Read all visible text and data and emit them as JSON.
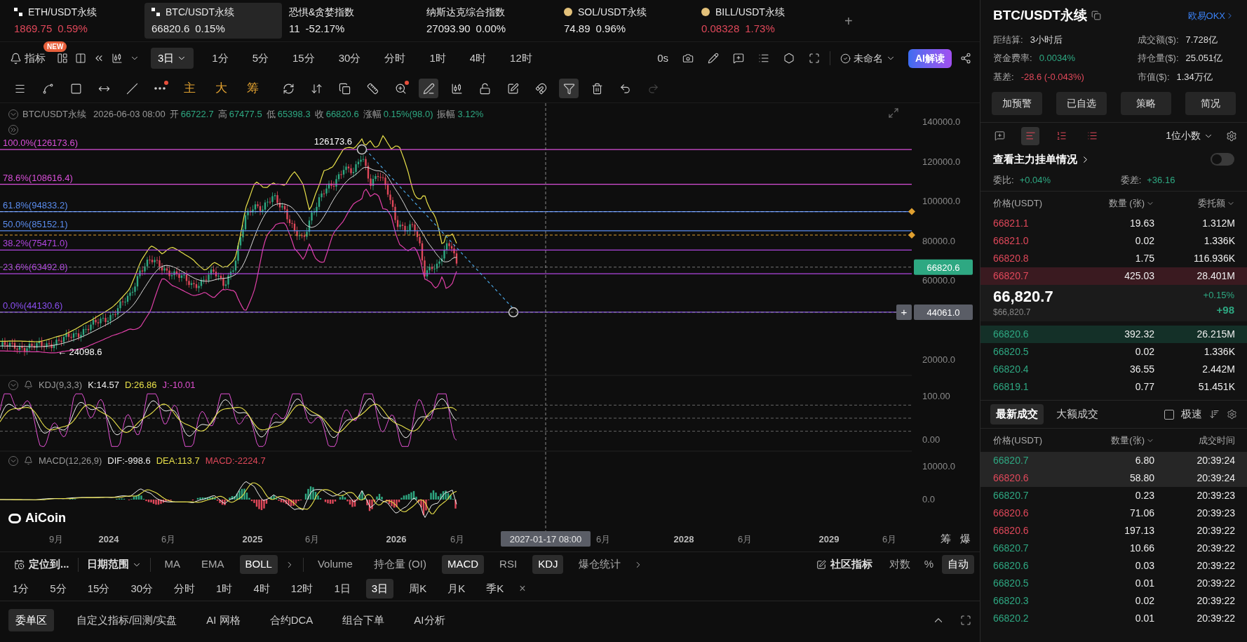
{
  "tickers": [
    {
      "symbol": "ETH/USDT永续",
      "price": "1869.75",
      "change": "0.59%",
      "color": "#e0485a",
      "selected": false
    },
    {
      "symbol": "BTC/USDT永续",
      "price": "66820.6",
      "change": "0.15%",
      "color": "#e8e8e8",
      "selected": true
    },
    {
      "symbol": "恐惧&贪婪指数",
      "price": "11",
      "change": "-52.17%",
      "color": "#e8e8e8",
      "selected": false
    },
    {
      "symbol": "纳斯达克综合指数",
      "price": "27093.90",
      "change": "0.00%",
      "color": "#e8e8e8",
      "selected": false
    },
    {
      "symbol": "SOL/USDT永续",
      "price": "74.89",
      "change": "0.96%",
      "color": "#e8e8e8",
      "selected": false
    },
    {
      "symbol": "BILL/USDT永续",
      "price": "0.08328",
      "change": "1.73%",
      "color": "#e0485a",
      "selected": false
    }
  ],
  "add_tab": "+",
  "toolbar": {
    "indicator": "指标",
    "badge": "NEW",
    "period": "3日",
    "timeframes": [
      "1分",
      "5分",
      "15分",
      "30分",
      "分时",
      "1时",
      "4时",
      "12时"
    ],
    "countdown": "0s",
    "layout_name": "未命名",
    "ai_button": "AI解读"
  },
  "drawing_tools": [
    {
      "kind": "icon",
      "selected": false,
      "disabled": false
    },
    {
      "kind": "icon",
      "selected": false,
      "disabled": false
    },
    {
      "kind": "icon",
      "selected": false,
      "disabled": false
    },
    {
      "kind": "icon",
      "selected": false,
      "disabled": false
    },
    {
      "kind": "icon",
      "selected": false,
      "disabled": false
    },
    {
      "kind": "icon",
      "selected": false,
      "disabled": false
    },
    {
      "kind": "text",
      "label": "主"
    },
    {
      "kind": "text",
      "label": "大"
    },
    {
      "kind": "text",
      "label": "筹"
    },
    {
      "kind": "icon",
      "selected": false,
      "disabled": false
    },
    {
      "kind": "icon",
      "selected": false,
      "disabled": false
    },
    {
      "kind": "icon",
      "selected": false,
      "disabled": false
    },
    {
      "kind": "icon",
      "selected": false,
      "disabled": false
    },
    {
      "kind": "icon",
      "selected": false,
      "disabled": false
    },
    {
      "kind": "icon",
      "selected": true,
      "disabled": false
    },
    {
      "kind": "icon",
      "selected": false,
      "disabled": false
    },
    {
      "kind": "icon",
      "selected": false,
      "disabled": false
    },
    {
      "kind": "icon",
      "selected": false,
      "disabled": false
    },
    {
      "kind": "icon",
      "selected": false,
      "disabled": false
    },
    {
      "kind": "icon",
      "selected": true,
      "disabled": false
    },
    {
      "kind": "icon",
      "selected": false,
      "disabled": false
    },
    {
      "kind": "icon",
      "selected": false,
      "disabled": false
    },
    {
      "kind": "icon",
      "selected": false,
      "disabled": true
    }
  ],
  "chart": {
    "info": {
      "symbol": "BTC/USDT永续",
      "time": "2026-06-03 08:00",
      "fields": [
        {
          "label": "开",
          "value": "66722.7"
        },
        {
          "label": "高",
          "value": "67477.5"
        },
        {
          "label": "低",
          "value": "65398.3"
        },
        {
          "label": "收",
          "value": "66820.6"
        },
        {
          "label": "涨幅",
          "value": "0.15%(98.0)"
        },
        {
          "label": "振幅",
          "value": "3.12%"
        }
      ]
    },
    "fib_levels": [
      {
        "label": "100.0%(126173.6)",
        "color": "#d94fd9"
      },
      {
        "label": "78.6%(108616.4)",
        "color": "#d94fd9"
      },
      {
        "label": "61.8%(94833.2)",
        "color": "#5b8def"
      },
      {
        "label": "50.0%(85152.1)",
        "color": "#5b8def"
      },
      {
        "label": "38.2%(75471.0)",
        "color": "#b046e0"
      },
      {
        "label": "23.6%(63492.8)",
        "color": "#b046e0"
      },
      {
        "label": "0.0%(44130.6)",
        "color": "#8a4ff0"
      }
    ],
    "high_label": "126173.6",
    "low_label": "← 24098.6",
    "y_ticks": [
      "140000.0",
      "120000.0",
      "100000.0",
      "80000.0",
      "60000.0",
      "20000.0"
    ],
    "last_price": "66820.6",
    "crosshair_price": "44061.0",
    "crosshair_plus": "+",
    "kdj": {
      "name": "KDJ(9,3,3)",
      "values": [
        "K:14.57",
        "D:26.86",
        "J:-10.01"
      ],
      "ticks": [
        "100.00",
        "0.00"
      ]
    },
    "macd": {
      "name": "MACD(12,26,9)",
      "values": [
        "DIF:-998.6",
        "DEA:113.7",
        "MACD:-2224.7"
      ],
      "ticks": [
        "10000.0",
        "0.0"
      ]
    },
    "brand": "AiCoin",
    "x_labels": [
      "9月",
      "2024",
      "6月",
      "2025",
      "6月",
      "2026",
      "6月",
      "6月",
      "2028",
      "6月",
      "2029",
      "6月"
    ],
    "crosshair_time": "2027-01-17 08:00",
    "side_buttons": [
      "筹",
      "爆"
    ]
  },
  "indicator_bar": {
    "locate": "定位到...",
    "date_range": "日期范围",
    "main": [
      {
        "label": "MA",
        "selected": false
      },
      {
        "label": "EMA",
        "selected": false
      },
      {
        "label": "BOLL",
        "selected": true
      }
    ],
    "sub": [
      {
        "label": "Volume",
        "selected": false
      },
      {
        "label": "持仓量 (OI)",
        "selected": false
      },
      {
        "label": "MACD",
        "selected": true
      },
      {
        "label": "RSI",
        "selected": false
      },
      {
        "label": "KDJ",
        "selected": true
      },
      {
        "label": "爆仓统计",
        "selected": false
      }
    ],
    "community": "社区指标",
    "scales": [
      {
        "label": "对数",
        "selected": false
      },
      {
        "label": "%",
        "selected": false
      },
      {
        "label": "自动",
        "selected": true
      }
    ]
  },
  "timeframe_bar": [
    {
      "label": "1分",
      "selected": false
    },
    {
      "label": "5分",
      "selected": false
    },
    {
      "label": "15分",
      "selected": false
    },
    {
      "label": "30分",
      "selected": false
    },
    {
      "label": "分时",
      "selected": false
    },
    {
      "label": "1时",
      "selected": false
    },
    {
      "label": "4时",
      "selected": false
    },
    {
      "label": "12时",
      "selected": false
    },
    {
      "label": "1日",
      "selected": false
    },
    {
      "label": "3日",
      "selected": true
    },
    {
      "label": "周K",
      "selected": false
    },
    {
      "label": "月K",
      "selected": false
    },
    {
      "label": "季K",
      "selected": false
    }
  ],
  "timeframe_close": "×",
  "bottom_tabs": [
    {
      "label": "委单区",
      "selected": true
    },
    {
      "label": "自定义指标/回测/实盘",
      "selected": false
    },
    {
      "label": "AI 网格",
      "selected": false
    },
    {
      "label": "合约DCA",
      "selected": false
    },
    {
      "label": "组合下单",
      "selected": false
    },
    {
      "label": "AI分析",
      "selected": false
    }
  ],
  "panel": {
    "title": "BTC/USDT永续",
    "exchange": "欧易OKX",
    "stats": [
      {
        "label": "距结算:",
        "value": "3小时后",
        "color": "#dddddd"
      },
      {
        "label": "成交额($):",
        "value": "7.728亿",
        "color": "#dddddd"
      },
      {
        "label": "资金费率:",
        "value": "0.0034%",
        "color": "#2ea882"
      },
      {
        "label": "持仓量($):",
        "value": "25.051亿",
        "color": "#dddddd"
      },
      {
        "label": "基差:",
        "value": "-28.6 (-0.043%)",
        "color": "#e0485a"
      },
      {
        "label": "市值($):",
        "value": "1.34万亿",
        "color": "#dddddd"
      }
    ],
    "buttons": [
      "加预警",
      "已自选",
      "策略",
      "简况"
    ],
    "book_views": [
      {
        "selected": false
      },
      {
        "selected": true
      },
      {
        "selected": false
      },
      {
        "selected": false
      }
    ],
    "precision": "1位小数",
    "whale_orders": {
      "label": "查看主力挂单情况",
      "on": false
    },
    "ratio": {
      "label": "委比:",
      "value": "+0.04%"
    },
    "diff": {
      "label": "委差:",
      "value": "+36.16"
    },
    "book_columns": [
      "价格(USDT)",
      "数量 (张)",
      "委托额"
    ],
    "asks": [
      {
        "price": "66821.1",
        "qty": "19.63",
        "amount": "1.312M",
        "highlighted": false
      },
      {
        "price": "66821.0",
        "qty": "0.02",
        "amount": "1.336K",
        "highlighted": false
      },
      {
        "price": "66820.8",
        "qty": "1.75",
        "amount": "116.936K",
        "highlighted": false
      },
      {
        "price": "66820.7",
        "qty": "425.03",
        "amount": "28.401M",
        "highlighted": true
      }
    ],
    "mid": {
      "price": "66,820.7",
      "usd": "$66,820.7",
      "change_pct": "+0.15%",
      "change": "+98"
    },
    "bids": [
      {
        "price": "66820.6",
        "qty": "392.32",
        "amount": "26.215M",
        "highlighted": true
      },
      {
        "price": "66820.5",
        "qty": "0.02",
        "amount": "1.336K",
        "highlighted": false
      },
      {
        "price": "66820.4",
        "qty": "36.55",
        "amount": "2.442M",
        "highlighted": false
      },
      {
        "price": "66819.1",
        "qty": "0.77",
        "amount": "51.451K",
        "highlighted": false
      }
    ],
    "trade_tabs": [
      {
        "label": "最新成交",
        "selected": true
      },
      {
        "label": "大额成交",
        "selected": false
      }
    ],
    "fast_mode": {
      "label": "极速",
      "checked": false
    },
    "trade_columns": [
      "价格(USDT)",
      "数量(张)",
      "成交时间"
    ],
    "trades": [
      {
        "price": "66820.7",
        "qty": "6.80",
        "time": "20:39:24",
        "color": "#2ea882",
        "highlighted": true
      },
      {
        "price": "66820.6",
        "qty": "58.80",
        "time": "20:39:24",
        "color": "#e0485a",
        "highlighted": true
      },
      {
        "price": "66820.7",
        "qty": "0.23",
        "time": "20:39:23",
        "color": "#2ea882",
        "highlighted": false
      },
      {
        "price": "66820.6",
        "qty": "71.06",
        "time": "20:39:23",
        "color": "#e0485a",
        "highlighted": false
      },
      {
        "price": "66820.6",
        "qty": "197.13",
        "time": "20:39:22",
        "color": "#e0485a",
        "highlighted": false
      },
      {
        "price": "66820.7",
        "qty": "10.66",
        "time": "20:39:22",
        "color": "#2ea882",
        "highlighted": false
      },
      {
        "price": "66820.6",
        "qty": "0.03",
        "time": "20:39:22",
        "color": "#2ea882",
        "highlighted": false
      },
      {
        "price": "66820.5",
        "qty": "0.01",
        "time": "20:39:22",
        "color": "#2ea882",
        "highlighted": false
      },
      {
        "price": "66820.3",
        "qty": "0.02",
        "time": "20:39:22",
        "color": "#2ea882",
        "highlighted": false
      },
      {
        "price": "66820.2",
        "qty": "0.01",
        "time": "20:39:22",
        "color": "#2ea882",
        "highlighted": false
      }
    ]
  }
}
